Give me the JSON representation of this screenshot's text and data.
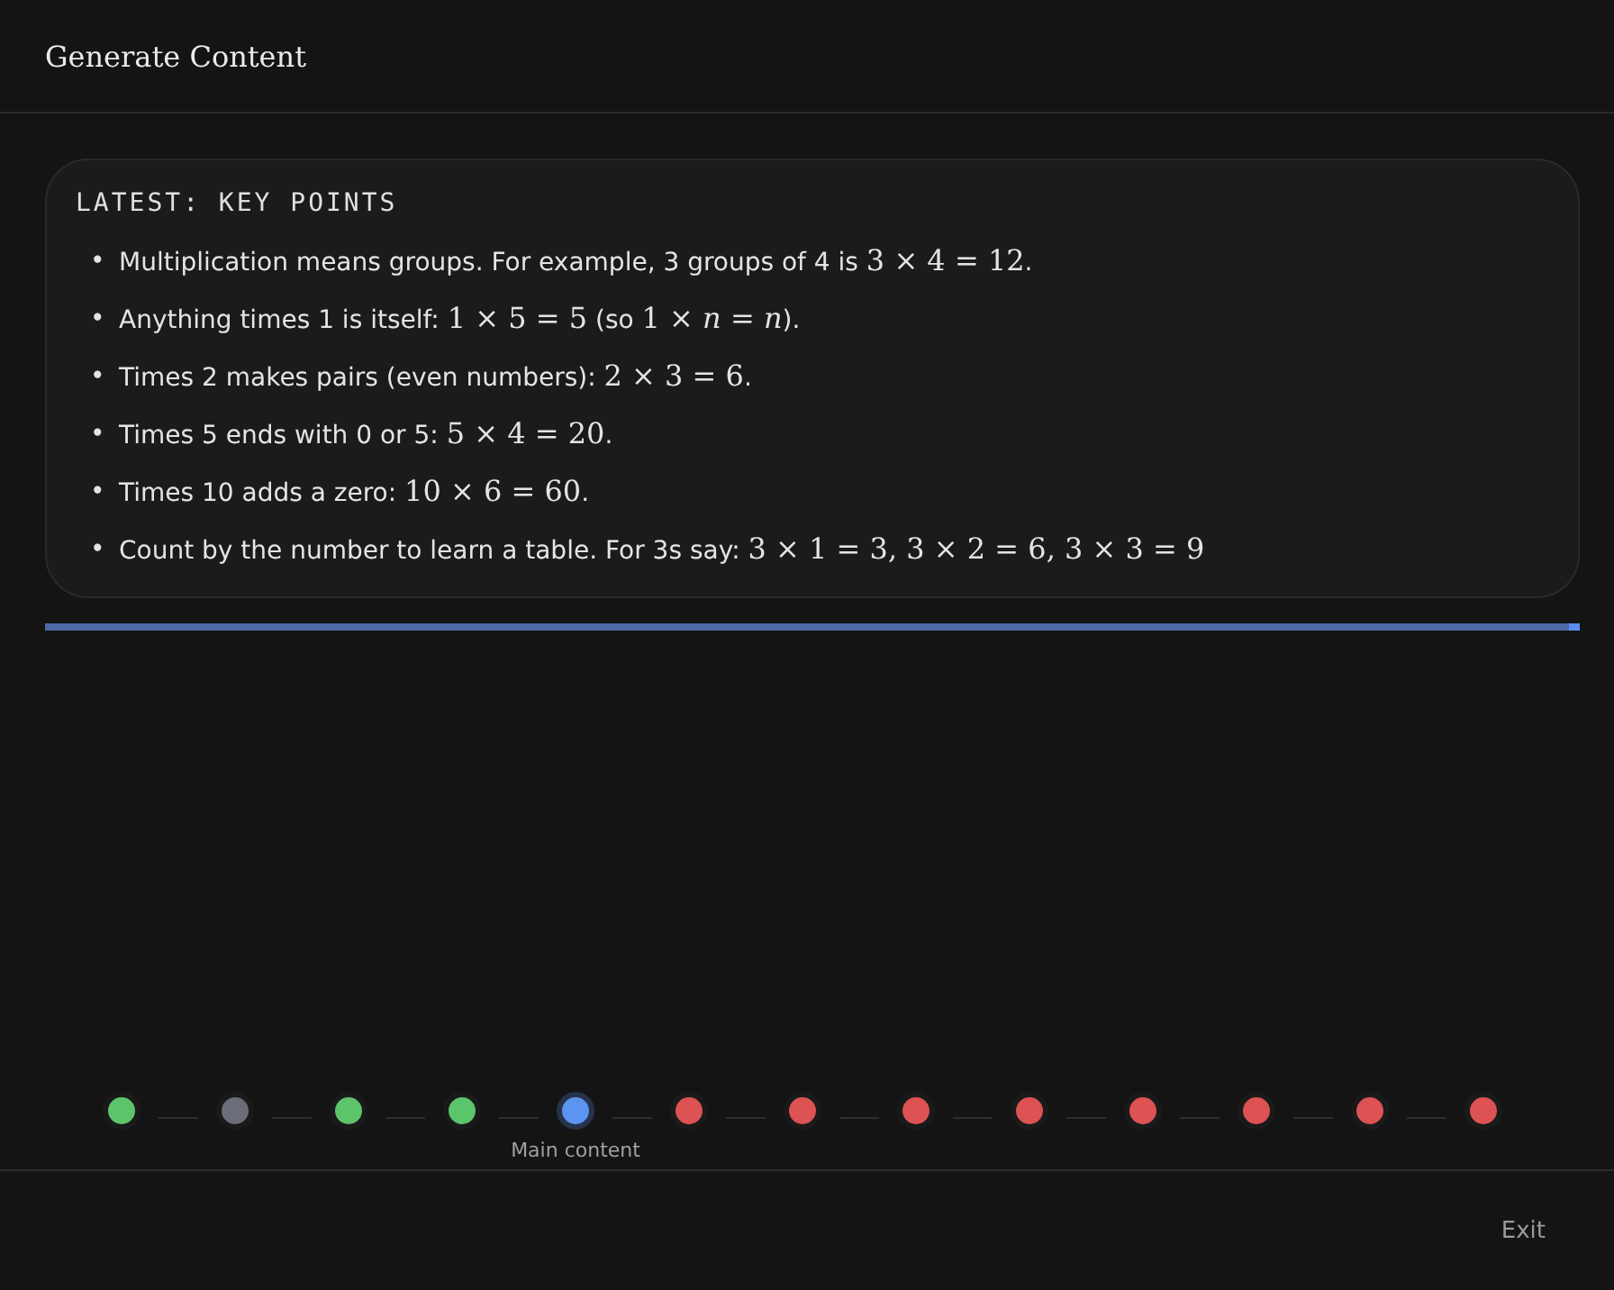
{
  "window": {
    "title": "Generate Content"
  },
  "card": {
    "heading": "LATEST: KEY POINTS",
    "points": [
      {
        "marker": "•",
        "parts": [
          {
            "kind": "text",
            "text": "Multiplication means groups. For example, 3 groups of 4 is "
          },
          {
            "kind": "math",
            "text": "3 × 4 = 12"
          },
          {
            "kind": "text",
            "text": "."
          }
        ]
      },
      {
        "marker": "•",
        "parts": [
          {
            "kind": "text",
            "text": "Anything times 1 is itself: "
          },
          {
            "kind": "math",
            "text": "1 × 5 = 5"
          },
          {
            "kind": "text",
            "text": " (so "
          },
          {
            "kind": "math",
            "text": "1 × *n* = *n*"
          },
          {
            "kind": "text",
            "text": ")."
          }
        ]
      },
      {
        "marker": "•",
        "parts": [
          {
            "kind": "text",
            "text": "Times 2 makes pairs (even numbers): "
          },
          {
            "kind": "math",
            "text": "2 × 3 = 6"
          },
          {
            "kind": "text",
            "text": "."
          }
        ]
      },
      {
        "marker": "•",
        "parts": [
          {
            "kind": "text",
            "text": "Times 5 ends with 0 or 5: "
          },
          {
            "kind": "math",
            "text": "5 × 4 = 20"
          },
          {
            "kind": "text",
            "text": "."
          }
        ]
      },
      {
        "marker": "•",
        "parts": [
          {
            "kind": "text",
            "text": "Times 10 adds a zero: "
          },
          {
            "kind": "math",
            "text": "10 × 6 = 60"
          },
          {
            "kind": "text",
            "text": "."
          }
        ]
      },
      {
        "marker": "•",
        "parts": [
          {
            "kind": "text",
            "text": "Count by the number to learn a table. For 3s say: "
          },
          {
            "kind": "math",
            "text": "3 × 1 = 3, 3 × 2 = 6, 3 × 3 = 9"
          }
        ]
      }
    ]
  },
  "progress": {
    "level": 1
  },
  "steps": [
    {
      "color": "#5cc46a",
      "selected": false
    },
    {
      "color": "#6b6e78",
      "selected": false
    },
    {
      "color": "#5cc46a",
      "selected": false
    },
    {
      "color": "#5cc46a",
      "selected": false
    },
    {
      "color": "#5b95f0",
      "selected": true,
      "label": "Main content"
    },
    {
      "color": "#dd5252",
      "selected": false
    },
    {
      "color": "#dd5252",
      "selected": false
    },
    {
      "color": "#dd5252",
      "selected": false
    },
    {
      "color": "#dd5252",
      "selected": false
    },
    {
      "color": "#dd5252",
      "selected": false
    },
    {
      "color": "#dd5252",
      "selected": false
    },
    {
      "color": "#dd5252",
      "selected": false
    },
    {
      "color": "#dd5252",
      "selected": false
    }
  ],
  "buttons": [
    {
      "label": "Exit"
    }
  ]
}
